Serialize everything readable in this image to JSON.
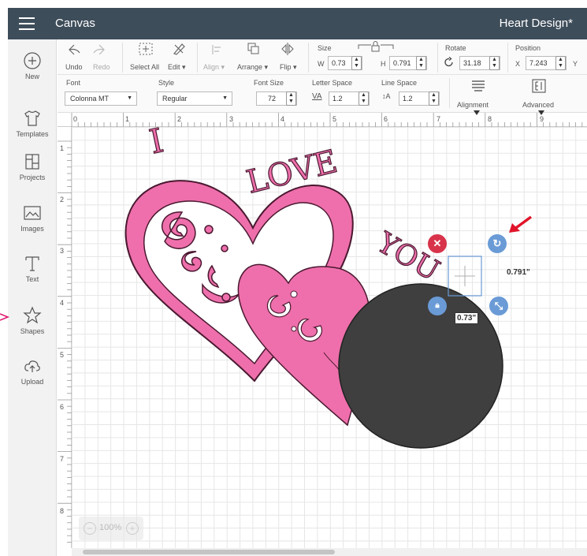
{
  "app": {
    "title": "Canvas",
    "document_title": "Heart Design*"
  },
  "nav": [
    {
      "label": "New",
      "icon": "plus-circle-icon"
    },
    {
      "label": "Templates",
      "icon": "shirt-icon"
    },
    {
      "label": "Projects",
      "icon": "projects-icon"
    },
    {
      "label": "Images",
      "icon": "image-icon"
    },
    {
      "label": "Text",
      "icon": "text-icon"
    },
    {
      "label": "Shapes",
      "icon": "shapes-icon"
    },
    {
      "label": "Upload",
      "icon": "upload-icon"
    }
  ],
  "toolbar": {
    "undo": "Undo",
    "redo": "Redo",
    "select_all": "Select All",
    "edit": "Edit",
    "align": "Align",
    "arrange": "Arrange",
    "flip": "Flip",
    "size_label": "Size",
    "w_label": "W",
    "w_value": "0.73",
    "h_label": "H",
    "h_value": "0.791",
    "rotate_label": "Rotate",
    "rotate_value": "31.18",
    "position_label": "Position",
    "x_label": "X",
    "x_value": "7.243",
    "y_label": "Y"
  },
  "textbar": {
    "font_label": "Font",
    "font_value": "Colonna MT",
    "style_label": "Style",
    "style_value": "Regular",
    "font_size_label": "Font Size",
    "font_size_value": "72",
    "letter_space_label": "Letter Space",
    "letter_space_value": "1.2",
    "line_space_label": "Line Space",
    "line_space_value": "1.2",
    "alignment_label": "Alignment",
    "advanced_label": "Advanced"
  },
  "ruler": {
    "h": [
      "0",
      "1",
      "2",
      "3",
      "4",
      "5",
      "6",
      "7",
      "8",
      "9"
    ],
    "v": [
      "1",
      "2",
      "3",
      "4",
      "5",
      "6",
      "7",
      "8"
    ]
  },
  "design": {
    "text_i": "I",
    "text_love": "LOVE",
    "text_you": "YOU",
    "heart_color": "#ee6fab",
    "circle_color": "#3f3f3f",
    "outline_color": "#4a1830"
  },
  "selection": {
    "height_readout": "0.791\"",
    "width_readout": "0.73\""
  },
  "zoom": {
    "level": "100%"
  },
  "colors": {
    "topbar": "#3e4d5a",
    "delete": "#d8334a",
    "handle": "#6a9bd6",
    "arrow": "#e0142a"
  }
}
